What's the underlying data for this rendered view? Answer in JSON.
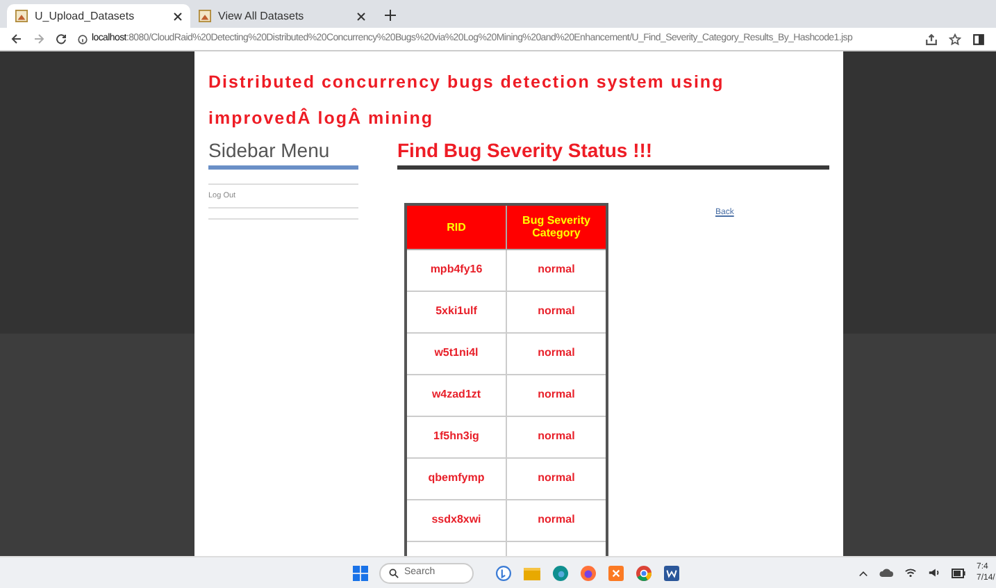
{
  "browser": {
    "tabs": [
      {
        "title": "U_Upload_Datasets",
        "selected": true
      },
      {
        "title": "View All Datasets",
        "selected": false
      }
    ],
    "url_host": "localhost",
    "url_rest": ":8080/CloudRaid%20Detecting%20Distributed%20Concurrency%20Bugs%20via%20Log%20Mining%20and%20Enhancement/U_Find_Severity_Category_Results_By_Hashcode1.jsp"
  },
  "page": {
    "title_lines": [
      "Distributed concurrency bugs detection system using",
      "improvedÂ logÂ mining"
    ],
    "sidebar": {
      "heading": "Sidebar Menu",
      "items": [
        "Log Out"
      ]
    },
    "heading": "Find Bug Severity Status !!!",
    "table": {
      "columns": [
        "RID",
        "Bug Severity Category"
      ],
      "rows": [
        [
          "mpb4fy16",
          "normal"
        ],
        [
          "5xki1ulf",
          "normal"
        ],
        [
          "w5t1ni4l",
          "normal"
        ],
        [
          "w4zad1zt",
          "normal"
        ],
        [
          "1f5hn3ig",
          "normal"
        ],
        [
          "qbemfymp",
          "normal"
        ],
        [
          "ssdx8xwi",
          "normal"
        ]
      ]
    },
    "back_link": "Back"
  },
  "taskbar": {
    "search_placeholder": "Search",
    "time": "7:4",
    "date": "7/14/"
  }
}
